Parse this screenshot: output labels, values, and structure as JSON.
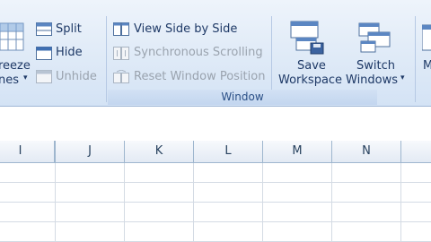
{
  "ribbon": {
    "freeze_panes_top": "reeze",
    "freeze_panes_bottom": "nes",
    "split_label": "Split",
    "hide_label": "Hide",
    "unhide_label": "Unhide",
    "view_side_by_side_label": "View Side by Side",
    "synchronous_scrolling_label": "Synchronous Scrolling",
    "reset_window_position_label": "Reset Window Position",
    "save_workspace_top": "Save",
    "save_workspace_bottom": "Workspace",
    "switch_windows_top": "Switch",
    "switch_windows_bottom": "Windows",
    "macros_partial": "M",
    "group_window_label": "Window"
  },
  "columns": [
    "I",
    "J",
    "K",
    "L",
    "M",
    "N"
  ],
  "icons": {
    "freeze": "freeze-panes-icon",
    "split": "split-icon",
    "hide": "hide-icon",
    "unhide": "unhide-icon",
    "side_by_side": "view-side-by-side-icon",
    "sync_scroll": "synchronous-scrolling-icon",
    "reset_window": "reset-window-position-icon",
    "save_workspace": "save-workspace-icon",
    "switch_windows": "switch-windows-icon"
  },
  "colors": {
    "ribbon_text": "#1e3966",
    "disabled_text": "#9aa3ae",
    "group_label": "#2a4f86",
    "grid": "#d4dbe4",
    "header_border": "#9eb6ce"
  }
}
